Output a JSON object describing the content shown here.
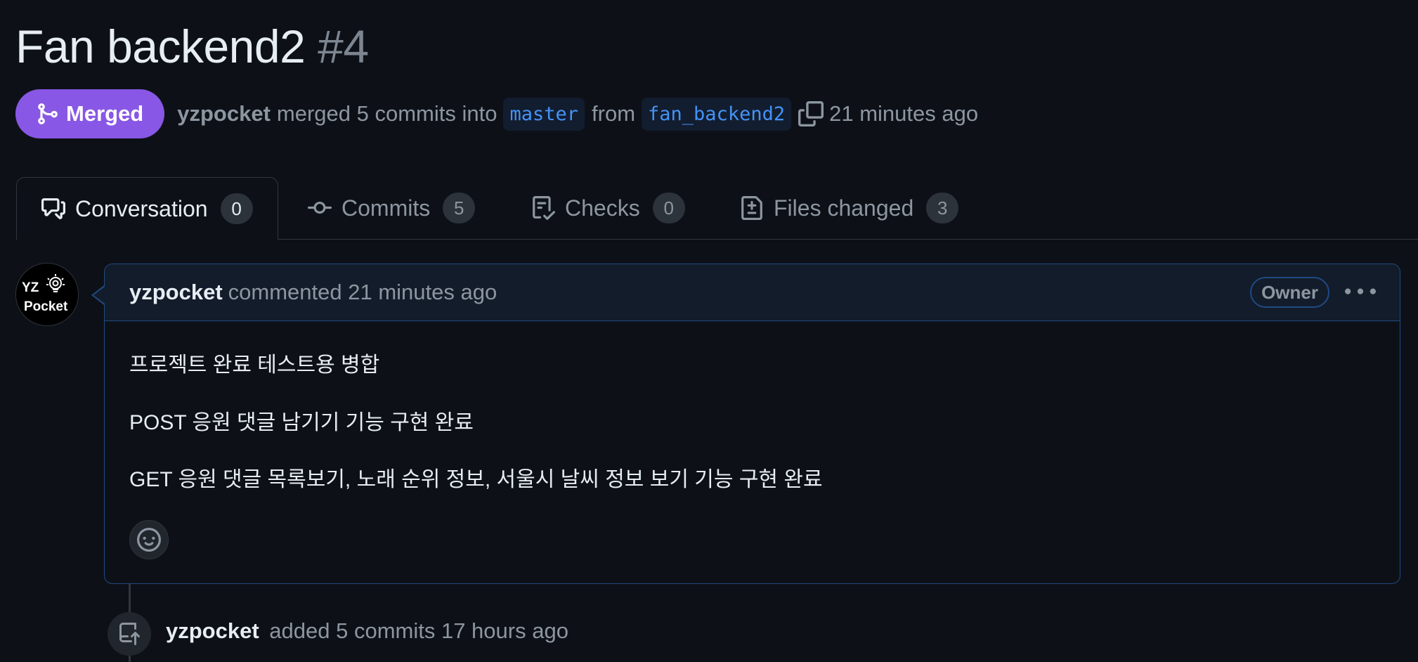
{
  "pr": {
    "title": "Fan backend2",
    "number": "#4"
  },
  "meta": {
    "status_label": "Merged",
    "author": "yzpocket",
    "action_text": "merged 5 commits into",
    "base_branch": "master",
    "from_text": "from",
    "head_branch": "fan_backend2",
    "time": "21 minutes ago"
  },
  "tabs": [
    {
      "label": "Conversation",
      "count": "0",
      "icon": "comment-discussion-icon"
    },
    {
      "label": "Commits",
      "count": "5",
      "icon": "git-commit-icon"
    },
    {
      "label": "Checks",
      "count": "0",
      "icon": "checklist-icon"
    },
    {
      "label": "Files changed",
      "count": "3",
      "icon": "file-diff-icon"
    }
  ],
  "comment": {
    "avatar_line1": "YZ",
    "avatar_line2": "Pocket",
    "author": "yzpocket",
    "action": "commented 21 minutes ago",
    "role_badge": "Owner",
    "body": [
      "프로젝트 완료 테스트용 병합",
      "POST 응원 댓글 남기기 기능 구현 완료",
      "GET 응원 댓글 목록보기, 노래 순위 정보, 서울시 날씨 정보 보기 기능 구현 완료"
    ]
  },
  "timeline": {
    "author": "yzpocket",
    "text": "added 5 commits 17 hours ago",
    "icon": "repo-push-icon"
  },
  "colors": {
    "background": "#0d1117",
    "merged": "#8957e5",
    "branch_text": "#4493f8",
    "border_accent": "#1f4a82"
  }
}
